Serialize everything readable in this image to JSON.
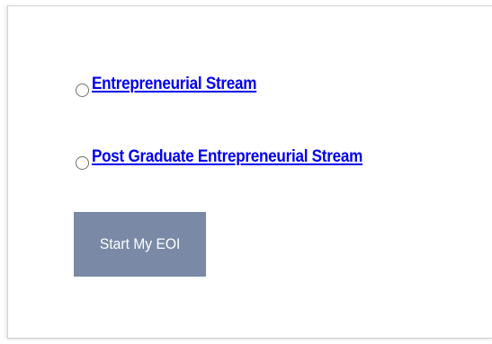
{
  "form": {
    "options": [
      {
        "label": "Entrepreneurial Stream",
        "selected": false
      },
      {
        "label": "Post Graduate Entrepreneurial Stream",
        "selected": false
      }
    ],
    "submit_label": "Start My EOI"
  },
  "colors": {
    "link": "#0000ee",
    "button_bg": "#7a8aa6",
    "button_text": "#ffffff"
  }
}
